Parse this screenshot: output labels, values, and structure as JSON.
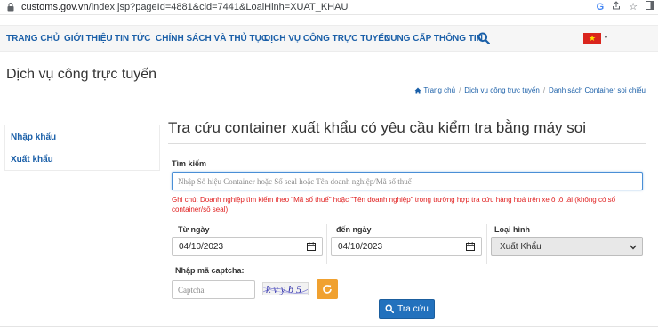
{
  "browser": {
    "url_domain": "customs.gov.vn",
    "url_path": "/index.jsp?pageId=4881&cid=7441&LoaiHinh=XUAT_KHAU",
    "icons": [
      "google-icon",
      "share-icon",
      "star-icon",
      "sidepanel-icon"
    ]
  },
  "nav": {
    "items": [
      {
        "label": "TRANG CHỦ"
      },
      {
        "label": "GIỚI THIỆU"
      },
      {
        "label": "TIN TỨC"
      },
      {
        "label": "CHÍNH SÁCH VÀ THỦ TỤC"
      },
      {
        "label": "DỊCH VỤ CÔNG TRỰC TUYẾN"
      },
      {
        "label": "CUNG CẤP THÔNG TIN"
      }
    ],
    "search_icon": "search-icon",
    "language_flag": "vietnam-flag-icon"
  },
  "page": {
    "title": "Dịch vụ công trực tuyến"
  },
  "breadcrumb": {
    "home": "Trang chủ",
    "level2": "Dịch vụ công trực tuyến",
    "current": "Danh sách Container soi chiếu"
  },
  "sidebar": {
    "items": [
      {
        "label": "Nhập khẩu"
      },
      {
        "label": "Xuất khẩu"
      }
    ]
  },
  "form": {
    "title": "Tra cứu container xuất khẩu có yêu cầu kiểm tra bằng máy soi",
    "search_label": "Tìm kiếm",
    "search_placeholder": "Nhập Số hiệu Container hoặc Số seal hoặc Tên doanh nghiệp/Mã số thuế",
    "search_value": "",
    "note": "Ghi chú: Doanh nghiệp tìm kiếm theo \"Mã số thuế\" hoặc \"Tên doanh nghiệp\" trong trường hợp tra cứu hàng hoá trên xe ô tô tải (không có số container/số seal)",
    "from_label": "Từ ngày",
    "from_value": "04/10/2023",
    "to_label": "đến ngày",
    "to_value": "04/10/2023",
    "type_label": "Loại hình",
    "type_value": "Xuất Khẩu",
    "captcha_label": "Nhập mã captcha:",
    "captcha_placeholder": "Captcha",
    "captcha_image_text": "kvyb5",
    "submit_label": "Tra cứu"
  },
  "colors": {
    "nav_text": "#1a5fa8",
    "note_text": "#e02020",
    "submit_bg": "#2271bd",
    "refresh_bg": "#f0a130",
    "flag_red": "#da251d",
    "flag_star": "#ffde00"
  }
}
